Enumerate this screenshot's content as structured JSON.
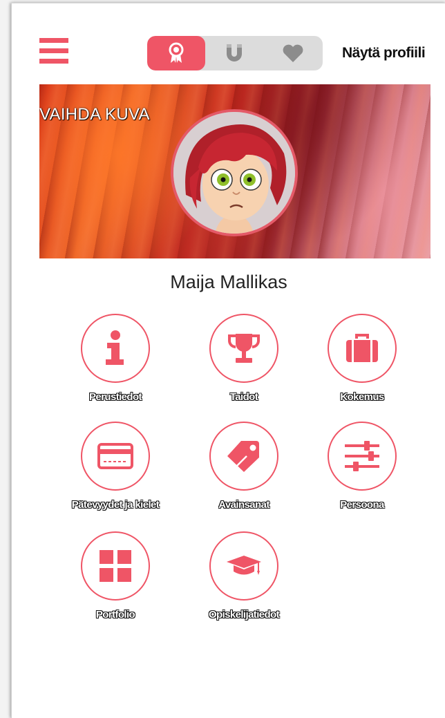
{
  "header": {
    "show_profile_label": "Näytä profiili",
    "segments": [
      {
        "name": "badge-icon",
        "active": true
      },
      {
        "name": "magnet-icon",
        "active": false
      },
      {
        "name": "heart-icon",
        "active": false
      }
    ]
  },
  "banner": {
    "change_image_label": "VAIHDA KUVA"
  },
  "profile": {
    "name": "Maija Mallikas"
  },
  "tiles": [
    {
      "label": "Perustiedot",
      "icon": "info-icon"
    },
    {
      "label": "Taidot",
      "icon": "trophy-icon"
    },
    {
      "label": "Kokemus",
      "icon": "briefcase-icon"
    },
    {
      "label": "Pätevyydet ja kielet",
      "icon": "credit-card-icon"
    },
    {
      "label": "Avainsanat",
      "icon": "tag-icon"
    },
    {
      "label": "Persoona",
      "icon": "sliders-icon"
    },
    {
      "label": "Portfolio",
      "icon": "grid-icon"
    },
    {
      "label": "Opiskelijatiedot",
      "icon": "graduation-cap-icon"
    }
  ],
  "colors": {
    "accent": "#ef5566",
    "segment_bg": "#dcdcdc",
    "inactive_icon": "#8c8c8c"
  }
}
